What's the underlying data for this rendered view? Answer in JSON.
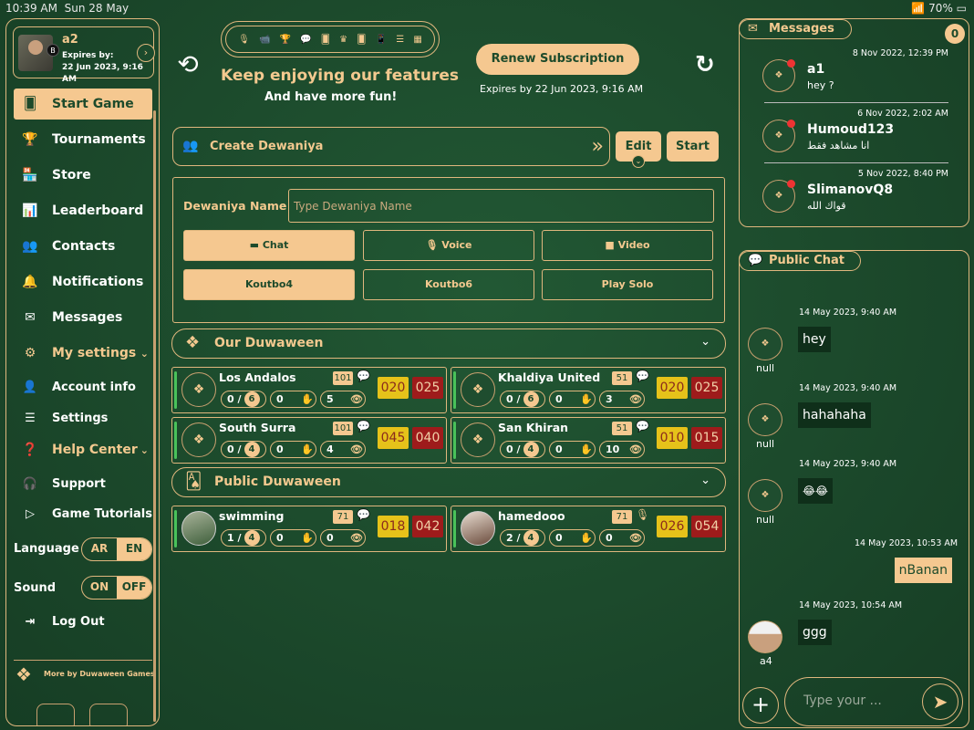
{
  "status": {
    "time": "10:39 AM",
    "date": "Sun 28 May",
    "battery": "70%"
  },
  "profile": {
    "name": "a2",
    "badge": "B",
    "expires_label": "Expires by:",
    "expires_value": "22 Jun 2023, 9:16 AM"
  },
  "nav": {
    "start_game": "Start Game",
    "tournaments": "Tournaments",
    "store": "Store",
    "leaderboard": "Leaderboard",
    "contacts": "Contacts",
    "notifications": "Notifications",
    "messages": "Messages",
    "my_settings": "My settings",
    "account_info": "Account info",
    "settings": "Settings",
    "help_center": "Help Center",
    "support": "Support",
    "game_tutorials": "Game Tutorials",
    "log_out": "Log Out",
    "more_games": "More by Duwaween Games"
  },
  "language": {
    "label": "Language",
    "ar": "AR",
    "en": "EN",
    "selected": "EN"
  },
  "sound": {
    "label": "Sound",
    "on": "ON",
    "off": "OFF",
    "selected": "ON"
  },
  "header": {
    "promo_title": "Keep enjoying our features",
    "promo_sub": "And have more fun!",
    "renew": "Renew Subscription",
    "expires": "Expires by 22 Jun 2023, 9:16 AM"
  },
  "create": {
    "label": "Create Dewaniya",
    "edit": "Edit",
    "start": "Start",
    "name_label": "Dewaniya Name",
    "name_placeholder": "Type Dewaniya Name",
    "chat": "Chat",
    "voice": "Voice",
    "video": "Video",
    "koutbo4": "Koutbo4",
    "koutbo6": "Koutbo6",
    "play_solo": "Play Solo"
  },
  "sections": {
    "our": "Our Duwaween",
    "public": "Public Duwaween"
  },
  "our_cards": [
    {
      "name": "Los Andalos",
      "level": "101",
      "players": "0",
      "cap": "6",
      "count2": "0",
      "count3": "5",
      "score1": "020",
      "score2": "025"
    },
    {
      "name": "Khaldiya United",
      "level": "51",
      "players": "0",
      "cap": "6",
      "count2": "0",
      "count3": "3",
      "score1": "020",
      "score2": "025"
    },
    {
      "name": "South Surra",
      "level": "101",
      "players": "0",
      "cap": "4",
      "count2": "0",
      "count3": "4",
      "score1": "045",
      "score2": "040"
    },
    {
      "name": "San Khiran",
      "level": "51",
      "players": "0",
      "cap": "4",
      "count2": "0",
      "count3": "10",
      "score1": "010",
      "score2": "015"
    }
  ],
  "public_cards": [
    {
      "name": "swimming",
      "level": "71",
      "players": "1",
      "cap": "4",
      "count2": "0",
      "count3": "0",
      "score1": "018",
      "score2": "042"
    },
    {
      "name": "hamedooo",
      "level": "71",
      "players": "2",
      "cap": "4",
      "count2": "0",
      "count3": "0",
      "score1": "026",
      "score2": "054"
    }
  ],
  "messages": {
    "title": "Messages",
    "count": "0",
    "items": [
      {
        "name": "a1",
        "text": "hey ?",
        "date": "8 Nov 2022, 12:39 PM"
      },
      {
        "name": "Humoud123",
        "text": "انا مشاهد فقط",
        "date": "6 Nov 2022, 2:02 AM"
      },
      {
        "name": "SlimanovQ8",
        "text": "قواك الله",
        "date": "5 Nov 2022, 8:40 PM"
      }
    ]
  },
  "public_chat": {
    "title": "Public Chat",
    "placeholder": "Type your ...",
    "items": [
      {
        "date": "14 May 2023, 9:40 AM",
        "user": "null",
        "text": "hey",
        "mine": false
      },
      {
        "date": "14 May 2023, 9:40 AM",
        "user": "null",
        "text": "hahahaha",
        "mine": false
      },
      {
        "date": "14 May 2023, 9:40 AM",
        "user": "null",
        "text": "😂😂",
        "mine": false
      },
      {
        "date": "14 May 2023, 10:53 AM",
        "user": "",
        "text": "nBanan",
        "mine": true
      },
      {
        "date": "14 May 2023, 10:54 AM",
        "user": "a4",
        "text": "ggg",
        "mine": false
      }
    ]
  }
}
